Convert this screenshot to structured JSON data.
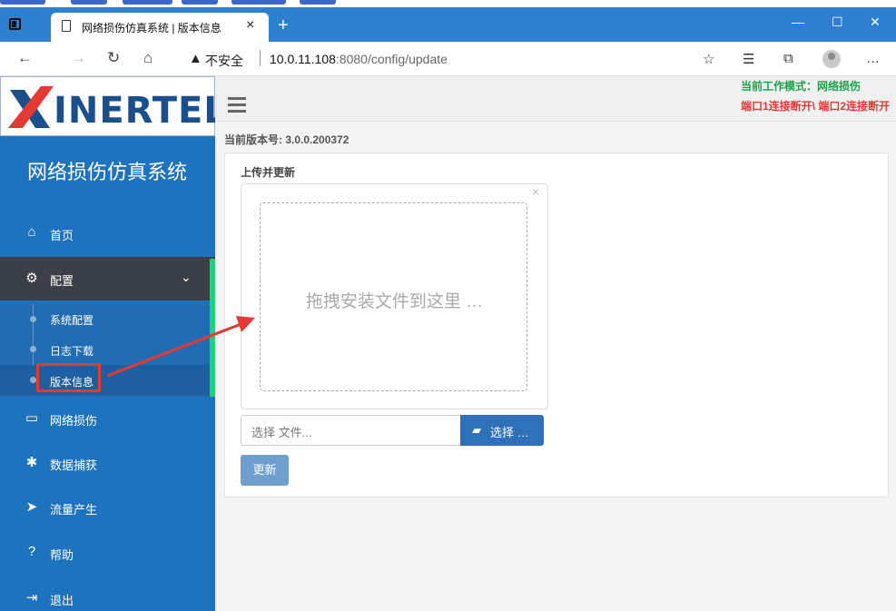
{
  "browser": {
    "tab_title": "网络损伤仿真系统 | 版本信息",
    "tab_close": "×",
    "new_tab": "+",
    "url_security": "不安全",
    "url_host": "10.0.11.108",
    "url_port_path": ":8080/config/update",
    "window_controls": [
      "—",
      "☐",
      "✕"
    ]
  },
  "sidebar": {
    "logo_text": "INERTEL",
    "system_name": "网络损伤仿真系统",
    "items": [
      {
        "label": "首页",
        "icon": "home-icon"
      },
      {
        "label": "配置",
        "icon": "gear-icon"
      },
      {
        "label": "网络损伤",
        "icon": "monitor-icon"
      },
      {
        "label": "数据捕获",
        "icon": "bug-icon"
      },
      {
        "label": "流量产生",
        "icon": "paper-plane-icon"
      },
      {
        "label": "帮助",
        "icon": "question-icon"
      },
      {
        "label": "退出",
        "icon": "sign-out-icon"
      }
    ],
    "submenu": [
      {
        "label": "系统配置"
      },
      {
        "label": "日志下载"
      },
      {
        "label": "版本信息"
      }
    ]
  },
  "header": {
    "mode": "当前工作模式：网络损伤",
    "port_status": "端口1连接断开\\ 端口2连接断开"
  },
  "content": {
    "version": "当前版本号: 3.0.0.200372",
    "panel_title": "上传并更新",
    "dropzone_text": "拖拽安装文件到这里 …",
    "file_placeholder": "选择 文件...",
    "browse_label": "选择 …",
    "update_label": "更新"
  },
  "colors": {
    "sidebar": "#1e73be",
    "active_menu": "#3b3f47",
    "accent_green": "#2bcb7e",
    "mode_green": "#1aa34a",
    "alert_red": "#e53935",
    "button_blue": "#2e71b8"
  }
}
